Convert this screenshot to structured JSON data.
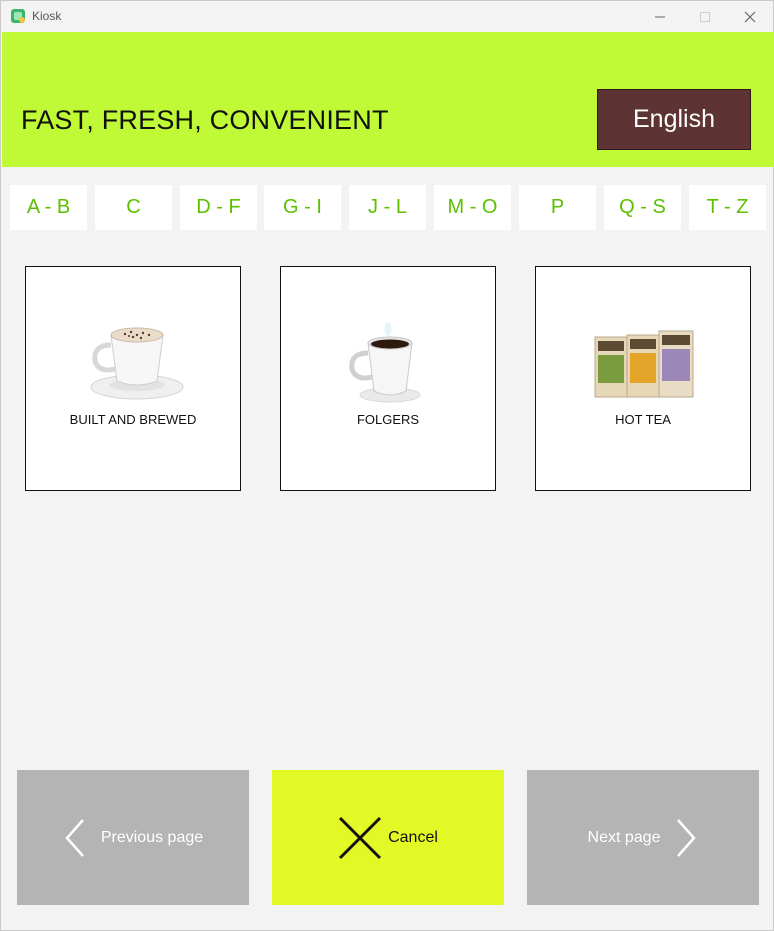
{
  "window": {
    "title": "Kiosk",
    "app_icon": "kiosk-app-icon",
    "controls": {
      "minimize": "minimize-icon",
      "maximize": "maximize-icon",
      "close": "close-icon"
    }
  },
  "header": {
    "tagline": "FAST, FRESH, CONVENIENT",
    "language_button": "English",
    "background_color": "#c0f936",
    "language_button_color": "#5e3333"
  },
  "alpha_filters": [
    "A - B",
    "C",
    "D - F",
    "G - I",
    "J - L",
    "M - O",
    "P",
    "Q - S",
    "T - Z"
  ],
  "alpha_filter_color": "#5cc000",
  "products": [
    {
      "label": "BUILT AND BREWED",
      "icon": "cappuccino-cup-icon"
    },
    {
      "label": "FOLGERS",
      "icon": "coffee-cup-icon"
    },
    {
      "label": "HOT TEA",
      "icon": "tea-boxes-icon"
    }
  ],
  "footer": {
    "previous_label": "Previous page",
    "cancel_label": "Cancel",
    "next_label": "Next page",
    "previous_icon": "chevron-left-icon",
    "cancel_icon": "x-icon",
    "next_icon": "chevron-right-icon",
    "cancel_color": "#e3f926",
    "nav_color": "#b4b4b4"
  }
}
